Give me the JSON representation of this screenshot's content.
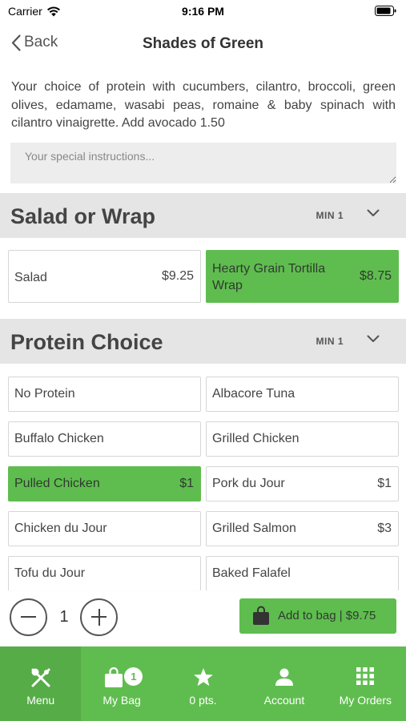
{
  "status_bar": {
    "carrier": "Carrier",
    "time": "9:16 PM"
  },
  "nav": {
    "back_label": "Back",
    "title": "Shades of Green"
  },
  "description": "Your choice of protein with cucumbers, cilantro, broccoli, green olives, edamame, wasabi peas, romaine & baby spinach with cilantro vinaigrette. Add avocado 1.50",
  "instructions": {
    "placeholder": "Your special instructions..."
  },
  "sections": [
    {
      "title": "Salad or Wrap",
      "min_label": "MIN 1",
      "options": [
        {
          "name": "Salad",
          "price": "$9.25",
          "selected": false
        },
        {
          "name": "Hearty Grain Tortilla Wrap",
          "price": "$8.75",
          "selected": true
        }
      ]
    },
    {
      "title": "Protein Choice",
      "min_label": "MIN 1",
      "options": [
        {
          "name": "No Protein",
          "price": "",
          "selected": false
        },
        {
          "name": "Albacore Tuna",
          "price": "",
          "selected": false
        },
        {
          "name": "Buffalo Chicken",
          "price": "",
          "selected": false
        },
        {
          "name": "Grilled Chicken",
          "price": "",
          "selected": false
        },
        {
          "name": "Pulled Chicken",
          "price": "$1",
          "selected": true
        },
        {
          "name": "Pork du Jour",
          "price": "$1",
          "selected": false
        },
        {
          "name": "Chicken du Jour",
          "price": "",
          "selected": false
        },
        {
          "name": "Grilled Salmon",
          "price": "$3",
          "selected": false
        },
        {
          "name": "Tofu du Jour",
          "price": "",
          "selected": false
        },
        {
          "name": "Baked Falafel",
          "price": "",
          "selected": false
        }
      ]
    }
  ],
  "quantity": {
    "value": "1"
  },
  "add_to_bag": {
    "label": "Add to bag  |  $9.75"
  },
  "tabs": [
    {
      "label": "Menu",
      "icon": "utensils-icon",
      "active": true
    },
    {
      "label": "My Bag",
      "icon": "bag-icon",
      "badge": "1"
    },
    {
      "label": "0 pts.",
      "icon": "star-icon"
    },
    {
      "label": "Account",
      "icon": "person-icon"
    },
    {
      "label": "My Orders",
      "icon": "grid-icon"
    }
  ],
  "colors": {
    "accent": "#5fbd4f",
    "accent_dark": "#56ac47",
    "section_bg": "#e5e5e5"
  }
}
